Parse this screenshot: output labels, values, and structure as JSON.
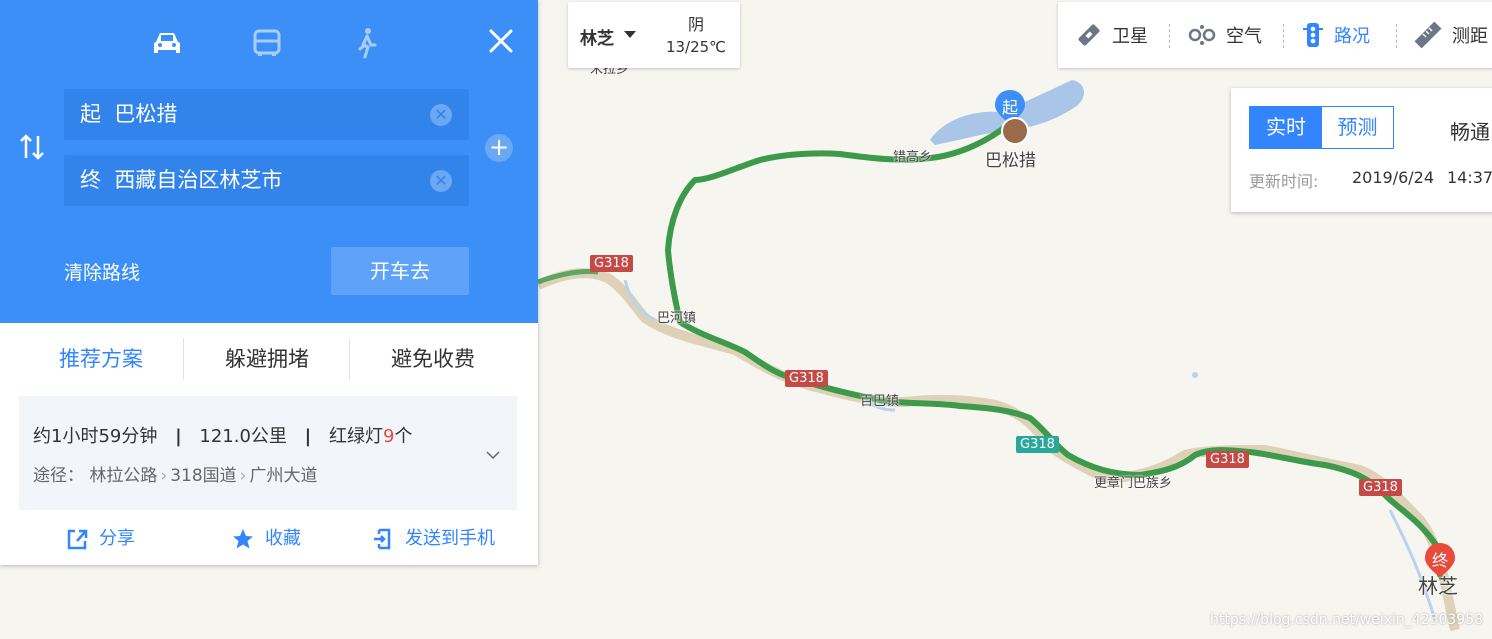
{
  "colors": {
    "accent": "#3d8ff8",
    "route_green": "#3d9a4a",
    "road_shield_red": "#c54a45",
    "road_shield_teal": "#2aa79a",
    "lake": "#a9c6e8",
    "marker_red": "#e84a3c",
    "marker_blue": "#3d8ff8"
  },
  "route_panel": {
    "modes": [
      {
        "icon": "car-icon"
      },
      {
        "icon": "bus-icon"
      },
      {
        "icon": "walk-icon"
      }
    ],
    "close_icon": "close-icon",
    "swap_icon": "swap-icon",
    "add_icon": "plus-icon",
    "start": {
      "prefix": "起",
      "value": "巴松措"
    },
    "end": {
      "prefix": "终",
      "value": "西藏自治区林芝市"
    },
    "clear_label": "清除路线",
    "go_label": "开车去",
    "tabs": [
      "推荐方案",
      "躲避拥堵",
      "避免收费"
    ],
    "summary": {
      "time": "约1小时59分钟",
      "distance": "121.0公里",
      "lights_prefix": "红绿灯",
      "lights_count": "9",
      "lights_suffix": "个",
      "sep": "|"
    },
    "via": {
      "label": "途径：",
      "roads": [
        "林拉公路",
        "318国道",
        "广州大道"
      ]
    },
    "actions": [
      {
        "icon": "share-icon",
        "label": "分享"
      },
      {
        "icon": "star-icon",
        "label": "收藏"
      },
      {
        "icon": "send-to-phone-icon",
        "label": "发送到手机"
      }
    ]
  },
  "weather": {
    "city": "林芝",
    "condition": "阴",
    "temp": "13/25℃"
  },
  "toolbar": {
    "items": [
      {
        "icon": "satellite-icon",
        "label": "卫星"
      },
      {
        "icon": "air-icon",
        "label": "空气"
      },
      {
        "icon": "traffic-light-icon",
        "label": "路况"
      },
      {
        "icon": "ruler-icon",
        "label": "测距"
      }
    ]
  },
  "traffic": {
    "tab_realtime": "实时",
    "tab_forecast": "预测",
    "status": "畅通",
    "update_label": "更新时间:",
    "update_date": "2019/6/24",
    "update_time": "14:37"
  },
  "map": {
    "labels": {
      "cuogao": "错高乡",
      "basongcuo": "巴松措",
      "bahe": "巴河镇",
      "baiba": "百巴镇",
      "gengzhang": "更章门巴族乡",
      "linzhi": "林芝",
      "top_cut": "米拉乡"
    },
    "road": "G318",
    "start_marker": "起",
    "end_marker": "终",
    "watermark": "https://blog.csdn.net/weixin_42303958"
  }
}
